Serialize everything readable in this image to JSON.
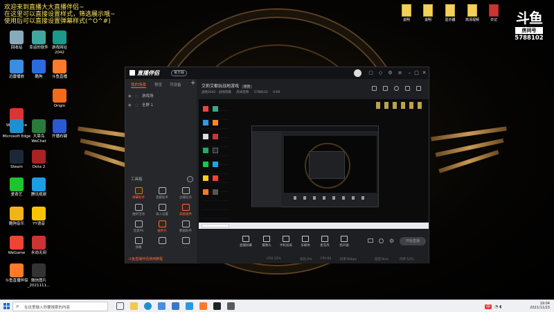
{
  "overlay": {
    "lines": [
      "欢迎来到直播大大直播伴侣~",
      "在这里可以直接设置样式，筛选展示哦~",
      "使用后可以直接设置弹幕样式(^O^#)"
    ]
  },
  "desktop_icons": [
    {
      "label": "回收站",
      "color": "#8ab"
    },
    {
      "label": "幸运的软件",
      "color": "#3fa7a0"
    },
    {
      "label": "游戏网址\n2042",
      "color": "#1a9a8a"
    },
    {
      "label": "迅雷播放",
      "color": "#3a8de0"
    },
    {
      "label": "酷狗",
      "color": "#2a6ce0"
    },
    {
      "label": "斗鱼直播",
      "color": "#ff7a2a"
    },
    {
      "label": "战地风云",
      "color": "#b33"
    },
    {
      "label": "AA",
      "color": "#ccc"
    },
    {
      "label": "Origin",
      "color": "#f56a1a"
    },
    {
      "label": "WPS Office",
      "color": "#d33"
    },
    {
      "label": "BATTLEGR...",
      "color": "#d8a23a"
    },
    {
      "label": "Microsoft Edge",
      "color": "#1e8fcf"
    },
    {
      "label": "大菜鸟\nWeChat",
      "color": "#2a7a3a"
    },
    {
      "label": "开播右键",
      "color": "#2a5ad0"
    },
    {
      "label": "Steam",
      "color": "#1b2838"
    },
    {
      "label": "Dota 2",
      "color": "#a22"
    },
    {
      "label": "爱奇艺",
      "color": "#1ec42e"
    },
    {
      "label": "腾讯视频",
      "color": "#1a9ee5"
    },
    {
      "label": "酷狗音乐",
      "color": "#f2b21a"
    },
    {
      "label": "YY语音",
      "color": "#f8c400"
    },
    {
      "label": "WeGame",
      "color": "#e43"
    },
    {
      "label": "永劫无间",
      "color": "#c33"
    },
    {
      "label": "斗鱼直播伴侣",
      "color": "#ff7a2a"
    },
    {
      "label": "微信图片\n_2021111...",
      "color": "#333"
    }
  ],
  "file_icons": [
    "说明",
    "说明",
    "显示器",
    "高清视频",
    "日记",
    "地图",
    "新建文件夹"
  ],
  "room_badge": {
    "logo": "斗鱼",
    "tag": "房间号",
    "number": "5788102"
  },
  "app": {
    "title": "直播伴侣",
    "version": "官方版",
    "left_tabs": [
      "我的场景",
      "预览",
      "可设备"
    ],
    "scenes": [
      "游戏场",
      "全屏 1"
    ],
    "add_scene": "+",
    "tools_title": "工具箱",
    "tools": [
      {
        "label": "弹幕助手",
        "active": true
      },
      {
        "label": "观看助手",
        "active": false
      },
      {
        "label": "主播任务",
        "active": false
      },
      {
        "label": "抽奖活动",
        "active": false
      },
      {
        "label": "录入设置",
        "active": false
      },
      {
        "label": "高级插件",
        "active": true
      },
      {
        "label": "连麦PK",
        "active": false
      },
      {
        "label": "抽奖包",
        "active": true
      },
      {
        "label": "数据助手",
        "active": false
      },
      {
        "label": "弹幕",
        "active": false
      },
      {
        "label": "…",
        "active": false
      },
      {
        "label": "…",
        "active": false
      }
    ],
    "left_footer": "斗鱼直播伴侣使用教程",
    "room_title": "艾莉艾都玩战地游戏",
    "room_edit": "修改",
    "room_meta": [
      "战地2042 - 战地风暴",
      "房间名称",
      "5788102",
      "0:00"
    ],
    "bottom_tools": [
      "直播屏幕",
      "摄像头",
      "手机投屏",
      "多媒体",
      "麦克风",
      "扬声器"
    ],
    "start_button": "开始直播",
    "status": [
      "CPU:12%",
      "丢包:0%",
      "FPS:60",
      "码率:0kbps",
      "延迟:0ms",
      "内存:53%"
    ]
  },
  "taskbar": {
    "search_placeholder": "在这里输入你要搜索的内容",
    "ime": "中",
    "time": "19:04",
    "date": "2021/11/23"
  }
}
